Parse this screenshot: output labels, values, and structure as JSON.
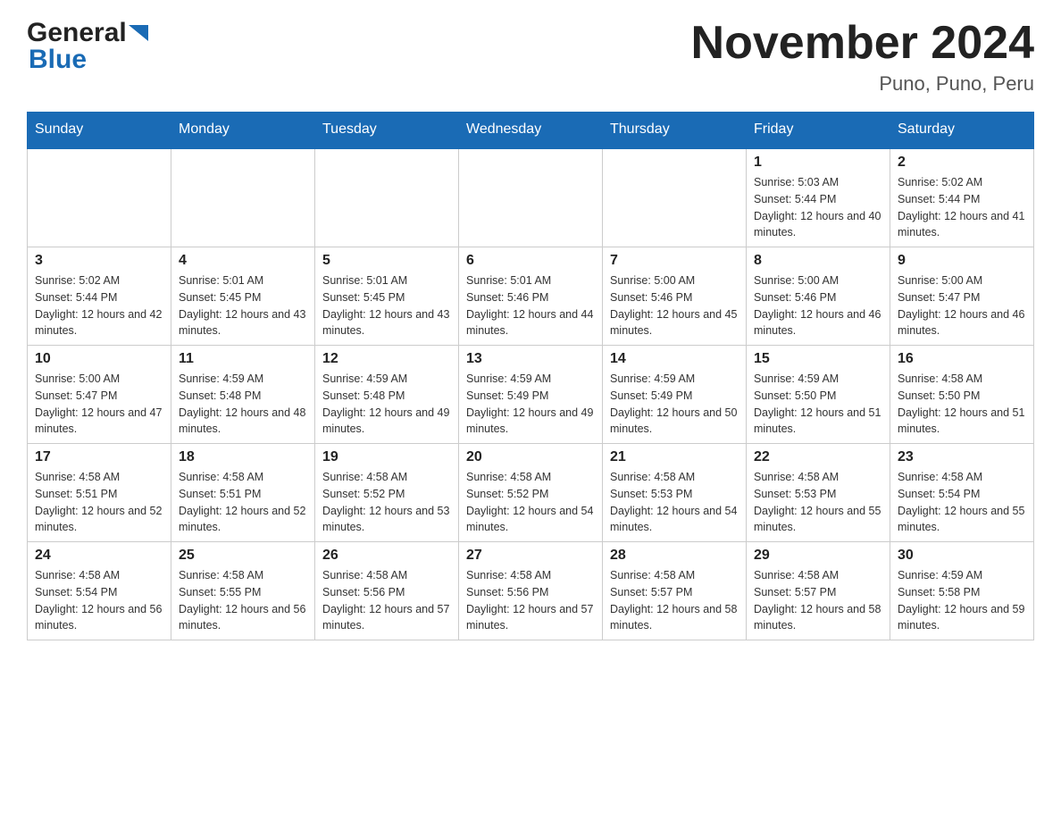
{
  "header": {
    "logo_general": "General",
    "logo_blue": "Blue",
    "month_title": "November 2024",
    "location": "Puno, Puno, Peru"
  },
  "weekdays": [
    "Sunday",
    "Monday",
    "Tuesday",
    "Wednesday",
    "Thursday",
    "Friday",
    "Saturday"
  ],
  "weeks": [
    [
      {
        "day": "",
        "sunrise": "",
        "sunset": "",
        "daylight": ""
      },
      {
        "day": "",
        "sunrise": "",
        "sunset": "",
        "daylight": ""
      },
      {
        "day": "",
        "sunrise": "",
        "sunset": "",
        "daylight": ""
      },
      {
        "day": "",
        "sunrise": "",
        "sunset": "",
        "daylight": ""
      },
      {
        "day": "",
        "sunrise": "",
        "sunset": "",
        "daylight": ""
      },
      {
        "day": "1",
        "sunrise": "Sunrise: 5:03 AM",
        "sunset": "Sunset: 5:44 PM",
        "daylight": "Daylight: 12 hours and 40 minutes."
      },
      {
        "day": "2",
        "sunrise": "Sunrise: 5:02 AM",
        "sunset": "Sunset: 5:44 PM",
        "daylight": "Daylight: 12 hours and 41 minutes."
      }
    ],
    [
      {
        "day": "3",
        "sunrise": "Sunrise: 5:02 AM",
        "sunset": "Sunset: 5:44 PM",
        "daylight": "Daylight: 12 hours and 42 minutes."
      },
      {
        "day": "4",
        "sunrise": "Sunrise: 5:01 AM",
        "sunset": "Sunset: 5:45 PM",
        "daylight": "Daylight: 12 hours and 43 minutes."
      },
      {
        "day": "5",
        "sunrise": "Sunrise: 5:01 AM",
        "sunset": "Sunset: 5:45 PM",
        "daylight": "Daylight: 12 hours and 43 minutes."
      },
      {
        "day": "6",
        "sunrise": "Sunrise: 5:01 AM",
        "sunset": "Sunset: 5:46 PM",
        "daylight": "Daylight: 12 hours and 44 minutes."
      },
      {
        "day": "7",
        "sunrise": "Sunrise: 5:00 AM",
        "sunset": "Sunset: 5:46 PM",
        "daylight": "Daylight: 12 hours and 45 minutes."
      },
      {
        "day": "8",
        "sunrise": "Sunrise: 5:00 AM",
        "sunset": "Sunset: 5:46 PM",
        "daylight": "Daylight: 12 hours and 46 minutes."
      },
      {
        "day": "9",
        "sunrise": "Sunrise: 5:00 AM",
        "sunset": "Sunset: 5:47 PM",
        "daylight": "Daylight: 12 hours and 46 minutes."
      }
    ],
    [
      {
        "day": "10",
        "sunrise": "Sunrise: 5:00 AM",
        "sunset": "Sunset: 5:47 PM",
        "daylight": "Daylight: 12 hours and 47 minutes."
      },
      {
        "day": "11",
        "sunrise": "Sunrise: 4:59 AM",
        "sunset": "Sunset: 5:48 PM",
        "daylight": "Daylight: 12 hours and 48 minutes."
      },
      {
        "day": "12",
        "sunrise": "Sunrise: 4:59 AM",
        "sunset": "Sunset: 5:48 PM",
        "daylight": "Daylight: 12 hours and 49 minutes."
      },
      {
        "day": "13",
        "sunrise": "Sunrise: 4:59 AM",
        "sunset": "Sunset: 5:49 PM",
        "daylight": "Daylight: 12 hours and 49 minutes."
      },
      {
        "day": "14",
        "sunrise": "Sunrise: 4:59 AM",
        "sunset": "Sunset: 5:49 PM",
        "daylight": "Daylight: 12 hours and 50 minutes."
      },
      {
        "day": "15",
        "sunrise": "Sunrise: 4:59 AM",
        "sunset": "Sunset: 5:50 PM",
        "daylight": "Daylight: 12 hours and 51 minutes."
      },
      {
        "day": "16",
        "sunrise": "Sunrise: 4:58 AM",
        "sunset": "Sunset: 5:50 PM",
        "daylight": "Daylight: 12 hours and 51 minutes."
      }
    ],
    [
      {
        "day": "17",
        "sunrise": "Sunrise: 4:58 AM",
        "sunset": "Sunset: 5:51 PM",
        "daylight": "Daylight: 12 hours and 52 minutes."
      },
      {
        "day": "18",
        "sunrise": "Sunrise: 4:58 AM",
        "sunset": "Sunset: 5:51 PM",
        "daylight": "Daylight: 12 hours and 52 minutes."
      },
      {
        "day": "19",
        "sunrise": "Sunrise: 4:58 AM",
        "sunset": "Sunset: 5:52 PM",
        "daylight": "Daylight: 12 hours and 53 minutes."
      },
      {
        "day": "20",
        "sunrise": "Sunrise: 4:58 AM",
        "sunset": "Sunset: 5:52 PM",
        "daylight": "Daylight: 12 hours and 54 minutes."
      },
      {
        "day": "21",
        "sunrise": "Sunrise: 4:58 AM",
        "sunset": "Sunset: 5:53 PM",
        "daylight": "Daylight: 12 hours and 54 minutes."
      },
      {
        "day": "22",
        "sunrise": "Sunrise: 4:58 AM",
        "sunset": "Sunset: 5:53 PM",
        "daylight": "Daylight: 12 hours and 55 minutes."
      },
      {
        "day": "23",
        "sunrise": "Sunrise: 4:58 AM",
        "sunset": "Sunset: 5:54 PM",
        "daylight": "Daylight: 12 hours and 55 minutes."
      }
    ],
    [
      {
        "day": "24",
        "sunrise": "Sunrise: 4:58 AM",
        "sunset": "Sunset: 5:54 PM",
        "daylight": "Daylight: 12 hours and 56 minutes."
      },
      {
        "day": "25",
        "sunrise": "Sunrise: 4:58 AM",
        "sunset": "Sunset: 5:55 PM",
        "daylight": "Daylight: 12 hours and 56 minutes."
      },
      {
        "day": "26",
        "sunrise": "Sunrise: 4:58 AM",
        "sunset": "Sunset: 5:56 PM",
        "daylight": "Daylight: 12 hours and 57 minutes."
      },
      {
        "day": "27",
        "sunrise": "Sunrise: 4:58 AM",
        "sunset": "Sunset: 5:56 PM",
        "daylight": "Daylight: 12 hours and 57 minutes."
      },
      {
        "day": "28",
        "sunrise": "Sunrise: 4:58 AM",
        "sunset": "Sunset: 5:57 PM",
        "daylight": "Daylight: 12 hours and 58 minutes."
      },
      {
        "day": "29",
        "sunrise": "Sunrise: 4:58 AM",
        "sunset": "Sunset: 5:57 PM",
        "daylight": "Daylight: 12 hours and 58 minutes."
      },
      {
        "day": "30",
        "sunrise": "Sunrise: 4:59 AM",
        "sunset": "Sunset: 5:58 PM",
        "daylight": "Daylight: 12 hours and 59 minutes."
      }
    ]
  ]
}
